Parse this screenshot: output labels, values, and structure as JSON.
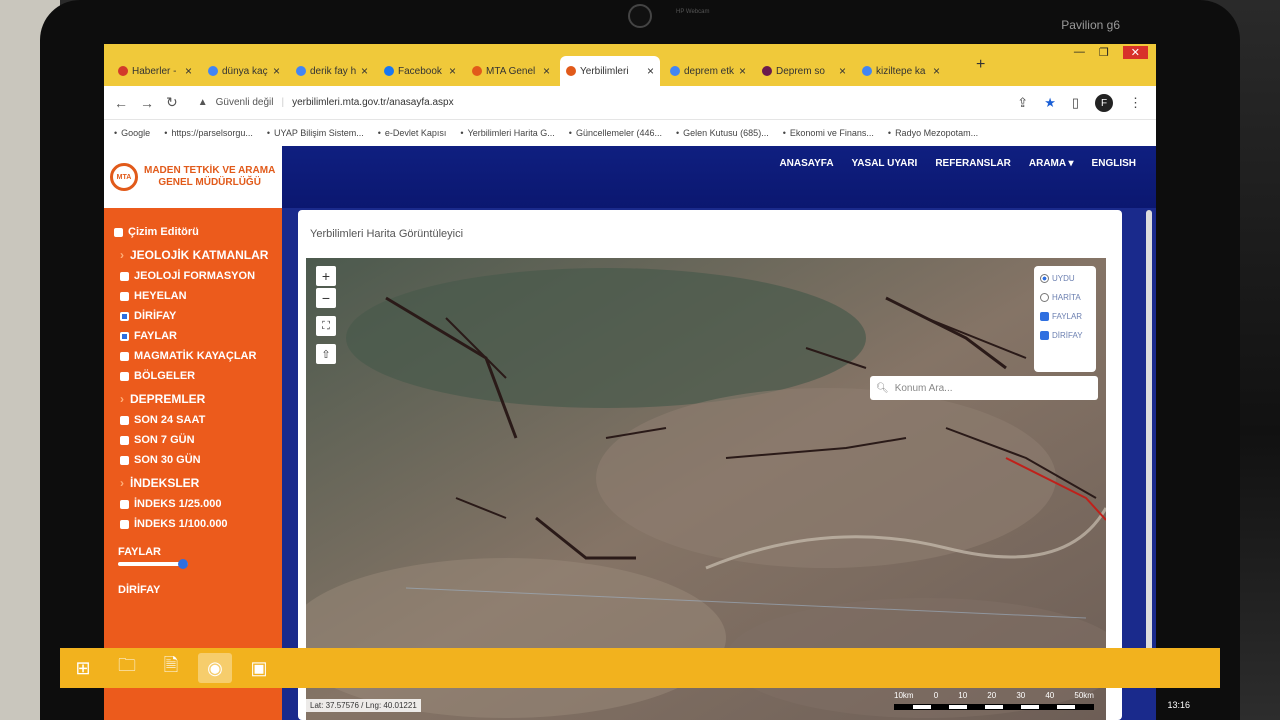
{
  "device": {
    "brand": "Pavilion g6",
    "webcam_label": "HP Webcam"
  },
  "tabs": [
    {
      "title": "Haberler -",
      "icon": "gmail-icon",
      "color": "#d23a2a"
    },
    {
      "title": "dünya kaç",
      "icon": "google-icon",
      "color": "#4285f4"
    },
    {
      "title": "derik fay h",
      "icon": "google-icon",
      "color": "#4285f4"
    },
    {
      "title": "Facebook",
      "icon": "facebook-icon",
      "color": "#1877f2"
    },
    {
      "title": "MTA Genel",
      "icon": "mta-icon",
      "color": "#e15a1a"
    },
    {
      "title": "Yerbilimleri",
      "icon": "mta-icon",
      "color": "#e15a1a"
    },
    {
      "title": "deprem etk",
      "icon": "google-icon",
      "color": "#4285f4"
    },
    {
      "title": "Deprem so",
      "icon": "news-icon",
      "color": "#6a1b4d"
    },
    {
      "title": "kiziltepe ka",
      "icon": "google-icon",
      "color": "#4285f4"
    }
  ],
  "address_bar": {
    "security": "Güvenli değil",
    "url": "yerbilimleri.mta.gov.tr/anasayfa.aspx",
    "profile_initial": "F"
  },
  "bookmarks": [
    {
      "label": "Google",
      "icon": "google-icon"
    },
    {
      "label": "https://parselsorgu...",
      "icon": "pin-icon"
    },
    {
      "label": "UYAP Bilişim Sistem...",
      "icon": "uyap-icon"
    },
    {
      "label": "e-Devlet Kapısı",
      "icon": "edevlet-icon"
    },
    {
      "label": "Yerbilimleri Harita G...",
      "icon": "mta-icon"
    },
    {
      "label": "Güncellemeler (446...",
      "icon": "gmail-icon"
    },
    {
      "label": "Gelen Kutusu (685)...",
      "icon": "gmail-icon"
    },
    {
      "label": "Ekonomi ve Finans...",
      "icon": "circle-icon"
    },
    {
      "label": "Radyo Mezopotam...",
      "icon": "music-icon"
    }
  ],
  "site": {
    "logo_abbr": "MTA",
    "logo_line1": "MADEN TETKİK VE ARAMA",
    "logo_line2": "GENEL MÜDÜRLÜĞÜ",
    "nav": [
      "ANASAYFA",
      "YASAL UYARI",
      "REFERANSLAR",
      "ARAMA ▾",
      "ENGLISH"
    ]
  },
  "sidebar": {
    "cizim": "Çizim Editörü",
    "jeolojik_head": "JEOLOJİK KATMANLAR",
    "jeolojik": [
      {
        "label": "JEOLOJİ FORMASYON",
        "checked": false
      },
      {
        "label": "HEYELAN",
        "checked": false
      },
      {
        "label": "DİRİFAY",
        "checked": true
      },
      {
        "label": "FAYLAR",
        "checked": true
      },
      {
        "label": "MAGMATİK KAYAÇLAR",
        "checked": false
      },
      {
        "label": "BÖLGELER",
        "checked": false
      }
    ],
    "depremler_head": "DEPREMLER",
    "depremler": [
      {
        "label": "SON 24 SAAT",
        "checked": false
      },
      {
        "label": "SON 7 GÜN",
        "checked": false
      },
      {
        "label": "SON 30 GÜN",
        "checked": false
      }
    ],
    "indeksler_head": "İNDEKSLER",
    "indeksler": [
      {
        "label": "İNDEKS 1/25.000",
        "checked": false
      },
      {
        "label": "İNDEKS 1/100.000",
        "checked": false
      }
    ],
    "faylar_slider_label": "FAYLAR",
    "faylar_slider_value": 1.0,
    "dirifay_label": "DİRİFAY"
  },
  "panel": {
    "title": "Yerbilimleri Harita Görüntüleyici"
  },
  "map": {
    "zoom_in": "+",
    "zoom_out": "−",
    "layer_uydu": "UYDU",
    "layer_harita": "HARİTA",
    "overlay_faylar": "FAYLAR",
    "overlay_dirifay": "DİRİFAY",
    "search_placeholder": "Konum Ara...",
    "coords": "Lat: 37.57576 / Lng: 40.01221",
    "scale_labels": [
      "10km",
      "0",
      "10",
      "20",
      "30",
      "40",
      "50km"
    ]
  },
  "taskbar": {
    "time": "13:16"
  }
}
